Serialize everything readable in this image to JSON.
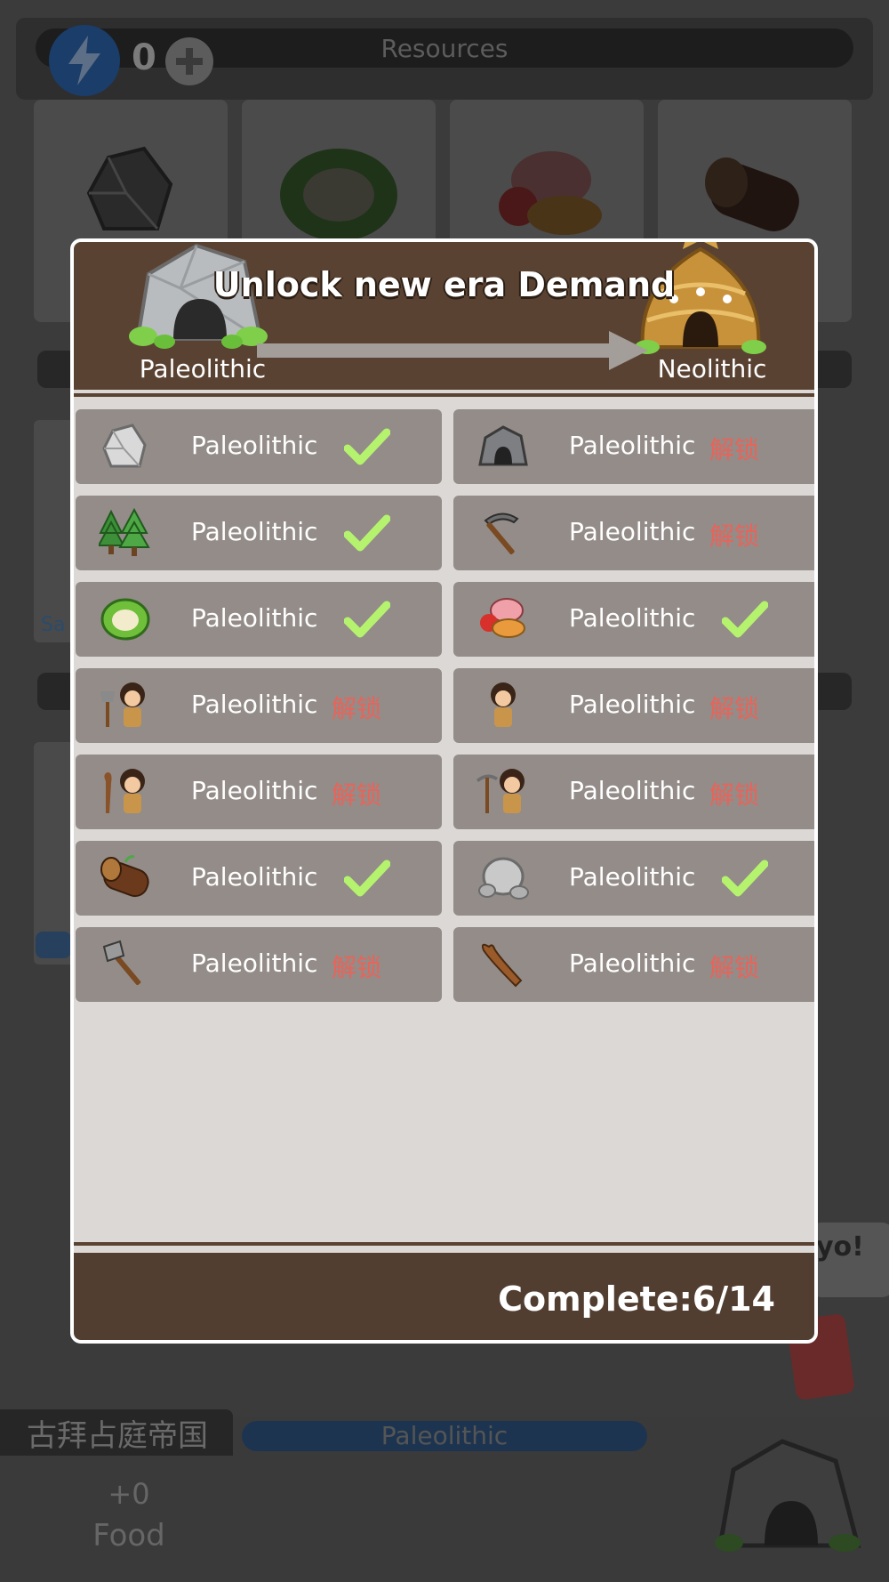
{
  "background": {
    "resources_title": "Resources",
    "energy_count": "0",
    "side_text": "Sa",
    "empire_name": "古拜占庭帝国",
    "era_pill": "Paleolithic",
    "food_value": "+0",
    "food_label": "Food",
    "speech_text": "yo!",
    "resource_icons": [
      "stone-icon",
      "fiber-icon",
      "food-icon",
      "wood-icon"
    ]
  },
  "modal": {
    "title": "Unlock new era Demand",
    "from_era": "Paleolithic",
    "to_era": "Neolithic",
    "complete_text": "Complete:6/14",
    "locked_text": "解锁",
    "check_color": "#b5f36e",
    "locked_color": "#e8645a",
    "requirements": [
      {
        "label": "Paleolithic",
        "icon": "stone-icon",
        "done": true
      },
      {
        "label": "Paleolithic",
        "icon": "cave-icon",
        "done": false
      },
      {
        "label": "Paleolithic",
        "icon": "forest-icon",
        "done": true
      },
      {
        "label": "Paleolithic",
        "icon": "pickaxe-icon",
        "done": false
      },
      {
        "label": "Paleolithic",
        "icon": "fiber-icon",
        "done": true
      },
      {
        "label": "Paleolithic",
        "icon": "food-icon",
        "done": true
      },
      {
        "label": "Paleolithic",
        "icon": "caveman-axe-icon",
        "done": false
      },
      {
        "label": "Paleolithic",
        "icon": "caveman-icon",
        "done": false
      },
      {
        "label": "Paleolithic",
        "icon": "caveman-club-icon",
        "done": false
      },
      {
        "label": "Paleolithic",
        "icon": "caveman-pickaxe-icon",
        "done": false
      },
      {
        "label": "Paleolithic",
        "icon": "wood-log-icon",
        "done": true
      },
      {
        "label": "Paleolithic",
        "icon": "rock-pile-icon",
        "done": true
      },
      {
        "label": "Paleolithic",
        "icon": "stone-axe-icon",
        "done": false
      },
      {
        "label": "Paleolithic",
        "icon": "club-icon",
        "done": false
      }
    ]
  }
}
